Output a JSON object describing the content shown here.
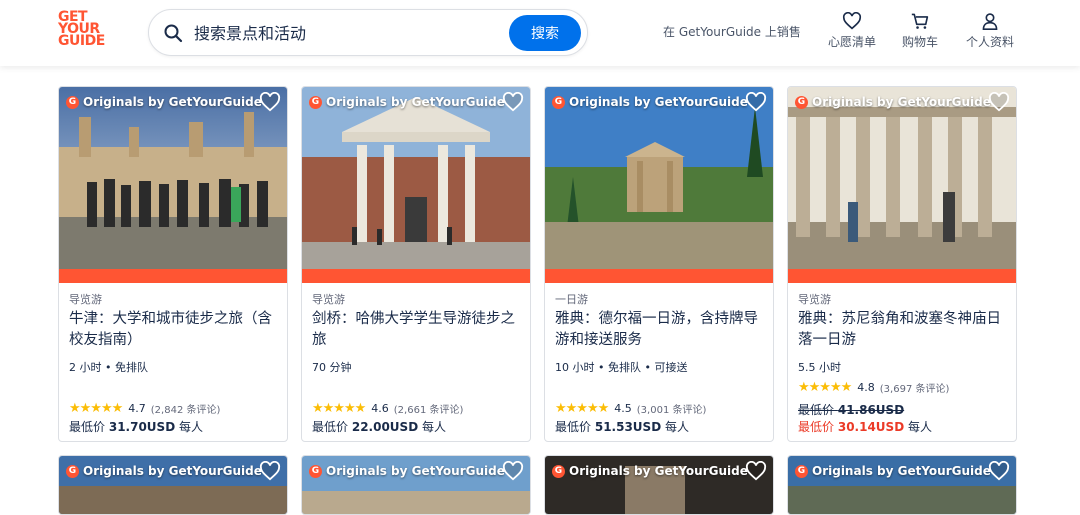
{
  "header": {
    "logo_lines": [
      "GET",
      "YOUR",
      "GUIDE"
    ],
    "search_placeholder": "搜索景点和活动",
    "search_button": "搜索",
    "sell_link": "在 GetYourGuide 上销售",
    "nav": [
      {
        "label": "心愿清单",
        "icon": "heart-icon"
      },
      {
        "label": "购物车",
        "icon": "cart-icon"
      },
      {
        "label": "个人资料",
        "icon": "user-icon"
      }
    ]
  },
  "colors": {
    "brand": "#ff5533",
    "primary": "#0071eb",
    "star": "#fbbd06",
    "sale": "#eb3a27"
  },
  "badge_label": "Originals by GetYourGuide",
  "cards": [
    {
      "category": "导览游",
      "title": "牛津：大学和城市徒步之旅（含校友指南）",
      "meta": "2 小时 • 免排队",
      "rating": "4.7",
      "reviews": "(2,842 条评论)",
      "price_label": "最低价",
      "price": "31.70USD",
      "per": "每人"
    },
    {
      "category": "导览游",
      "title": "剑桥：哈佛大学学生导游徒步之旅",
      "meta": "70 分钟",
      "rating": "4.6",
      "reviews": "(2,661 条评论)",
      "price_label": "最低价",
      "price": "22.00USD",
      "per": "每人"
    },
    {
      "category": "一日游",
      "title": "雅典：德尔福一日游，含持牌导游和接送服务",
      "meta": "10 小时 • 免排队 • 可接送",
      "rating": "4.5",
      "reviews": "(3,001 条评论)",
      "price_label": "最低价",
      "price": "51.53USD",
      "per": "每人"
    },
    {
      "category": "导览游",
      "title": "雅典：苏尼翁角和波塞冬神庙日落一日游",
      "meta": "5.5 小时",
      "rating": "4.8",
      "reviews": "(3,697 条评论)",
      "old_label": "最低价",
      "old_price": "41.86USD",
      "price_label": "最低价",
      "price": "30.14USD",
      "per": "每人",
      "sale": true
    }
  ]
}
